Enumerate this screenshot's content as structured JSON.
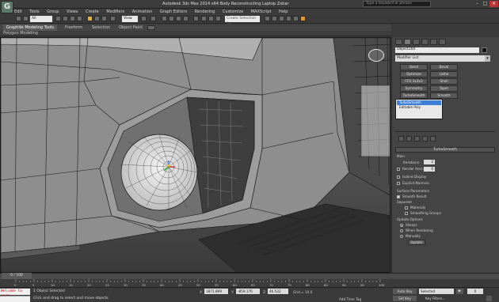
{
  "titlebar": {
    "logo": "G",
    "title": "Autodesk 3ds Max 2014 x64   Body Reconstructing Laptop Zobar",
    "search_placeholder": "Type a keyword or phrase"
  },
  "menubar": {
    "items": [
      "Edit",
      "Tools",
      "Group",
      "Views",
      "Create",
      "Modifiers",
      "Animation",
      "Graph Editors",
      "Rendering",
      "Customize",
      "MAXScript",
      "Help"
    ]
  },
  "toolbar": {
    "filter_value": "All",
    "view_value": "View",
    "selection_set_placeholder": "Create Selection Se"
  },
  "ribbon": {
    "tabs": [
      "Graphite Modeling Tools",
      "Freeform",
      "Selection",
      "Object Paint"
    ],
    "active_tab": 0,
    "subtitle": "Polygon Modeling"
  },
  "command_panel": {
    "object_name": "Object160",
    "modifier_list_label": "Modifier List",
    "modifier_buttons": [
      [
        "Bend",
        "Bevel"
      ],
      [
        "Optimize",
        "Lathe"
      ],
      [
        "FFD 3x3x3",
        "Shell"
      ],
      [
        "Symmetry",
        "Taper"
      ],
      [
        "TurboSmooth",
        "Smooth"
      ]
    ],
    "stack": [
      {
        "label": "TurboSmooth",
        "selected": true
      },
      {
        "label": "Editable Poly",
        "selected": false
      }
    ],
    "rollout_title": "TurboSmooth",
    "main_label": "Main",
    "iterations_label": "Iterations:",
    "iterations_value": "2",
    "render_iters_label": "Render Iters:",
    "render_iters_value": "0",
    "isoline_display": "Isoline Display",
    "explicit_normals": "Explicit Normals",
    "surface_params_label": "Surface Parameters",
    "smooth_result": "Smooth Result",
    "separate_label": "Separate",
    "materials": "Materials",
    "smoothing_groups": "Smoothing Groups",
    "update_options_label": "Update Options",
    "always": "Always",
    "when_rendering": "When Rendering",
    "manually": "Manually",
    "update_button": "Update"
  },
  "timeline": {
    "slider_text": "0 / 100",
    "ticks": [
      "0",
      "5",
      "10",
      "15",
      "20",
      "25",
      "30",
      "35",
      "40",
      "45",
      "50",
      "55",
      "60",
      "65",
      "70",
      "75",
      "80",
      "85",
      "90",
      "95",
      "100"
    ]
  },
  "statusbar": {
    "maxscript_text": "Welcome to MAXScr",
    "status_message": "1 Object Selected",
    "prompt_message": "Click and drag to select and move objects",
    "x_label": "X:",
    "x_value": "1871.899",
    "y_label": "Y:",
    "y_value": "-859.176",
    "z_label": "Z:",
    "z_value": "46.522",
    "grid_text": "Grid = 10.0",
    "add_time_tag": "Add Time Tag",
    "auto_key": "Auto Key",
    "set_key": "Set Key",
    "selected_value": "Selected",
    "key_filters": "Key Filters...",
    "frame_value": "0"
  },
  "colors": {
    "accent": "#3d7fd8",
    "viewport_bg": "#8a8a8a",
    "wire": "#1c1c1c",
    "panel": "#444444",
    "timeline_key": "#e8c200"
  }
}
